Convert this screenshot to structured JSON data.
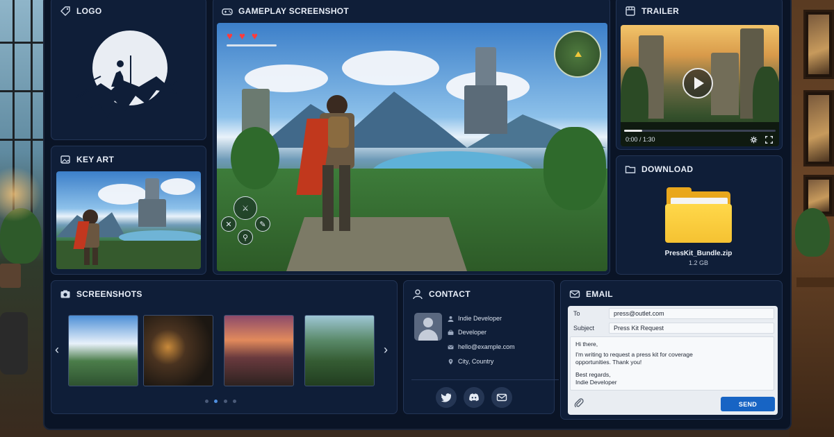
{
  "panels": {
    "logo": {
      "title": "LOGO"
    },
    "key_art": {
      "title": "KEY ART"
    },
    "gameplay": {
      "title": "GAMEPLAY SCREENSHOT"
    },
    "trailer": {
      "title": "TRAILER",
      "time": "0:00 / 1:30",
      "progress": 0.12
    },
    "download": {
      "title": "DOWNLOAD",
      "file_name": "PressKit_Bundle.zip",
      "file_size": "1.2 GB"
    },
    "screenshots": {
      "title": "SCREENSHOTS",
      "active_page": 2,
      "page_count": 4
    },
    "contact": {
      "title": "CONTACT",
      "name": "Indie Developer",
      "role": "Developer",
      "email": "hello@example.com",
      "location": "City, Country"
    },
    "email": {
      "title": "EMAIL",
      "to_label": "To",
      "to_value": "press@outlet.com",
      "subject_label": "Subject",
      "subject_value": "Press Kit Request",
      "body_line1": "Hi there,",
      "body_line2": "I'm writing to request a press kit for coverage",
      "body_line3": "opportunities. Thank you!",
      "body_line4": "Best regards,",
      "body_line5": "Indie Developer",
      "send_label": "SEND"
    }
  },
  "hud": {
    "hearts": 3,
    "health": 1.0
  },
  "colors": {
    "accent": "#1764c4",
    "panel": "#0f1e38",
    "folder": "#f5c232",
    "heart": "#ff3b3b"
  },
  "icons": [
    "tag-icon",
    "image-icon",
    "gamepad-icon",
    "film-icon",
    "folder-icon",
    "camera-icon",
    "user-icon",
    "mail-icon",
    "twitter-icon",
    "discord-icon",
    "paperclip-icon",
    "gear-icon",
    "fullscreen-icon",
    "play-icon"
  ]
}
